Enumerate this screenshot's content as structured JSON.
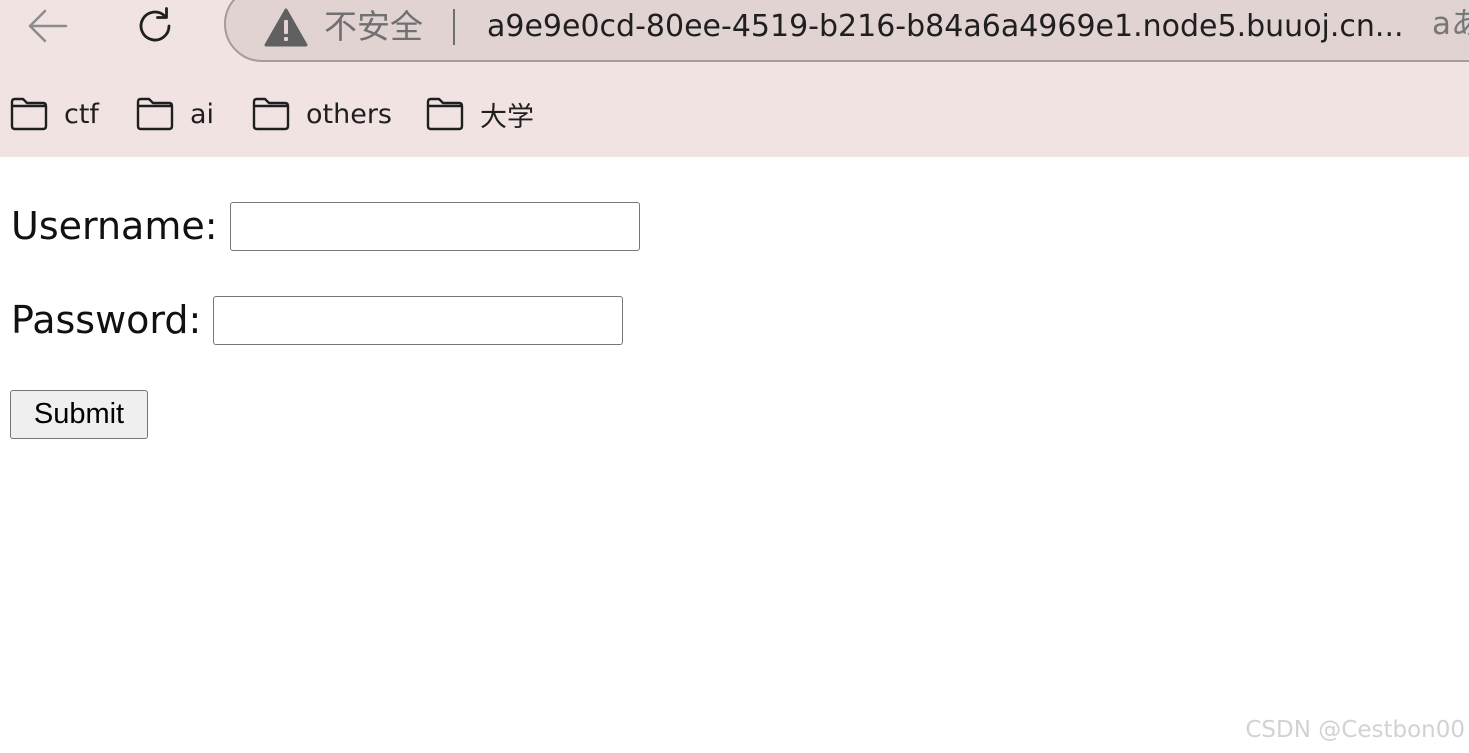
{
  "browser": {
    "address_bar": {
      "security_label": "不安全",
      "url": "a9e9e0cd-80ee-4519-b216-b84a6a4969e1.node5.buuoj.cn...",
      "read_aloud_glyph": "aあ"
    },
    "bookmarks": [
      {
        "label": "ctf",
        "icon": "folder-icon"
      },
      {
        "label": "ai",
        "icon": "folder-icon"
      },
      {
        "label": "others",
        "icon": "folder-icon"
      },
      {
        "label": "大学",
        "icon": "folder-icon"
      }
    ],
    "colors": {
      "chrome_background": "#f2e3e3",
      "address_bar_background": "#e2d3d3"
    }
  },
  "form": {
    "username_label": "Username:",
    "username_value": "",
    "password_label": "Password:",
    "password_value": "",
    "submit_label": "Submit"
  },
  "watermark": "CSDN @Cestbon00"
}
